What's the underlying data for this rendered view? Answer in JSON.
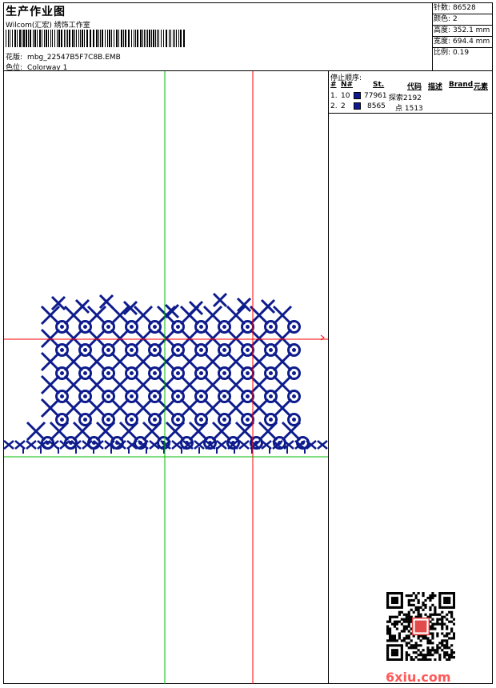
{
  "header": {
    "title": "生产作业图",
    "subtitle": "Wilcom(汇宏) 绣饰工作室",
    "design_label": "花版:",
    "design_file": "mbg_22547B5F7C8B.EMB",
    "colorway_label": "色位:",
    "colorway": "Colorway 1"
  },
  "stats": [
    {
      "label": "针数:",
      "value": "86528"
    },
    {
      "label": "颜色:",
      "value": "2"
    },
    {
      "label": "高度:",
      "value": "352.1 mm"
    },
    {
      "label": "宽度:",
      "value": "694.4 mm"
    },
    {
      "label": "比例:",
      "value": "0.19"
    }
  ],
  "stop_sequence": {
    "title": "停止顺序:",
    "columns": [
      "#",
      "N#",
      "St.",
      "代码",
      "描述",
      "Brand",
      "元素"
    ],
    "rows": [
      {
        "index": "1.",
        "needle": "10",
        "color": "#101890",
        "stitches": "77961",
        "element": "探索2192"
      },
      {
        "index": "2.",
        "needle": "2",
        "color": "#101890",
        "stitches": "8565",
        "element": "点 1513"
      }
    ]
  },
  "colors": {
    "stitch": "#0d1b8c",
    "guide_red": "#ff0000",
    "guide_green": "#00bb00"
  },
  "watermark": "6xiu.com"
}
